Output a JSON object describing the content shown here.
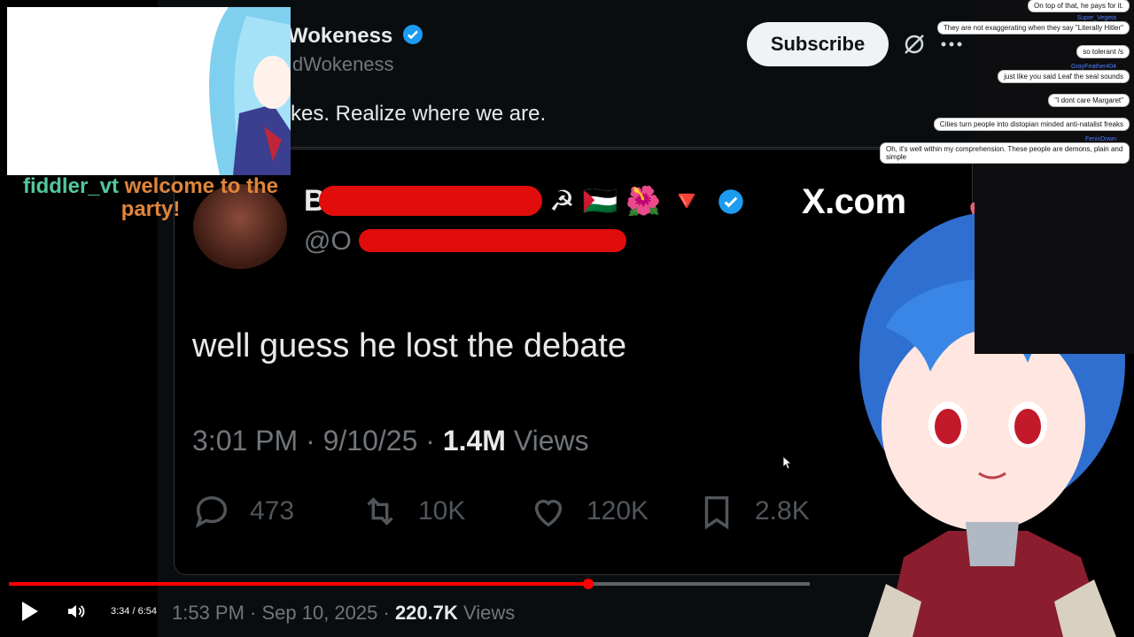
{
  "header": {
    "name": "Wokeness",
    "handle": "dWokeness",
    "tweet": "kes. Realize where we are.",
    "subscribe_label": "Subscribe"
  },
  "quoted": {
    "name": "Bl",
    "handle": "@O",
    "emojis": "☭ 🇵🇸 🌺 🔻",
    "brand": "X.com",
    "text": "well guess he lost the debate",
    "time": "3:01 PM · 9/10/25 · ",
    "views_count": "1.4M",
    "views_label": " Views",
    "actions": [
      {
        "icon": "reply-icon",
        "count": "473"
      },
      {
        "icon": "retweet-icon",
        "count": "10K"
      },
      {
        "icon": "like-icon",
        "count": "120K"
      },
      {
        "icon": "bookmark-icon",
        "count": "2.8K"
      }
    ]
  },
  "bottom_meta": {
    "time": "1:53 PM · Sep 10, 2025 · ",
    "views_count": "220.7K",
    "views_label": " Views"
  },
  "player": {
    "time": "3:34 / 6:54",
    "progress": 0.724,
    "colors": {
      "accent": "#ff0000"
    }
  },
  "overlay": {
    "welcome_user": "fiddler_vt",
    "welcome_text": " welcome to the party!"
  },
  "chat": [
    {
      "user": "",
      "text": "On top of that, he pays for it."
    },
    {
      "user": "Super_Vegeta",
      "text": "They are not exaggerating when they say \"Literally Hitler\""
    },
    {
      "user": "",
      "text": "so tolerant /s"
    },
    {
      "user": "GrayFeather404",
      "text": "just like you said Leaf the seal sounds"
    },
    {
      "user": "",
      "text": "\"I dont care Margaret\""
    },
    {
      "user": "",
      "text": "Cities turn people into distopian minded anti-natalist freaks"
    },
    {
      "user": "FenixDown",
      "text": "Oh, it's well within my comprehension. These people are demons, plain and simple"
    }
  ]
}
